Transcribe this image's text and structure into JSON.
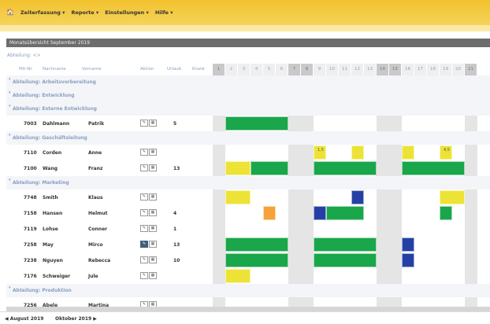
{
  "menubar": {
    "items": [
      {
        "label": "Zeiterfassung ▾",
        "name": "menu-zeiterfassung"
      },
      {
        "label": "Reporte ▾",
        "name": "menu-reporte"
      },
      {
        "label": "Einstellungen ▾",
        "name": "menu-einstellungen"
      },
      {
        "label": "Hilfe ▾",
        "name": "menu-hilfe"
      }
    ],
    "home_icon": "home-icon",
    "color": "#f2c12e"
  },
  "page_title": "Monatsübersicht September 2019",
  "filter_label": "Abteilung: <>",
  "columns": {
    "mit_nr": "Mit-Nr.",
    "nachname": "Nachname",
    "vorname": "Vorname",
    "aktion": "Aktion",
    "urlaub": "Urlaub",
    "krank": "Krank"
  },
  "days": [
    "1",
    "2",
    "3",
    "4",
    "5",
    "6",
    "7",
    "8",
    "9",
    "10",
    "11",
    "12",
    "13",
    "14",
    "15",
    "16",
    "17",
    "18",
    "19",
    "20",
    "21"
  ],
  "weekend_days": [
    1,
    7,
    8,
    14,
    15,
    21
  ],
  "departments": [
    {
      "label": "Abteilung: Arbeitsvorbereitung"
    },
    {
      "label": "Abteilung: Entwicklung"
    },
    {
      "label": "Abteilung: Externe Entwicklung"
    },
    {
      "label": "Abteilung: Geschäftsleitung"
    },
    {
      "label": "Abteilung: Marketing"
    },
    {
      "label": "Abteilung: Produktion"
    }
  ],
  "employees": [
    {
      "nr": "7003",
      "nachname": "Dahlmann",
      "vorname": "Patrik",
      "urlaub": "5",
      "krank": ""
    },
    {
      "nr": "7110",
      "nachname": "Corden",
      "vorname": "Anne",
      "urlaub": "",
      "krank": ""
    },
    {
      "nr": "7100",
      "nachname": "Wang",
      "vorname": "Franz",
      "urlaub": "13",
      "krank": ""
    },
    {
      "nr": "7748",
      "nachname": "Smith",
      "vorname": "Klaus",
      "urlaub": "",
      "krank": ""
    },
    {
      "nr": "7158",
      "nachname": "Hansen",
      "vorname": "Helmut",
      "urlaub": "4",
      "krank": ""
    },
    {
      "nr": "7119",
      "nachname": "Lohse",
      "vorname": "Conner",
      "urlaub": "1",
      "krank": ""
    },
    {
      "nr": "7258",
      "nachname": "May",
      "vorname": "Mirco",
      "urlaub": "13",
      "krank": ""
    },
    {
      "nr": "7238",
      "nachname": "Nguyen",
      "vorname": "Rebecca",
      "urlaub": "10",
      "krank": ""
    },
    {
      "nr": "7176",
      "nachname": "Schweiger",
      "vorname": "Jule",
      "urlaub": "",
      "krank": ""
    },
    {
      "nr": "7256",
      "nachname": "Abele",
      "vorname": "Martina",
      "urlaub": "",
      "krank": ""
    }
  ],
  "marks": [
    {
      "row": 0,
      "start": 2,
      "end": 6,
      "color": "#1aa64a"
    },
    {
      "row": 1,
      "start": 9,
      "end": 9,
      "color": "#ede337",
      "text": "1,5"
    },
    {
      "row": 1,
      "start": 12,
      "end": 12,
      "color": "#ede337"
    },
    {
      "row": 1,
      "start": 16,
      "end": 16,
      "color": "#ede337"
    },
    {
      "row": 1,
      "start": 19,
      "end": 19,
      "color": "#ede337",
      "text": "4,5"
    },
    {
      "row": 2,
      "start": 2,
      "end": 3,
      "color": "#ede337"
    },
    {
      "row": 2,
      "start": 4,
      "end": 6,
      "color": "#1aa64a"
    },
    {
      "row": 2,
      "start": 9,
      "end": 13,
      "color": "#1aa64a"
    },
    {
      "row": 2,
      "start": 16,
      "end": 20,
      "color": "#1aa64a"
    },
    {
      "row": 3,
      "start": 2,
      "end": 3,
      "color": "#ede337"
    },
    {
      "row": 3,
      "start": 12,
      "end": 12,
      "color": "#2540a5"
    },
    {
      "row": 3,
      "start": 19,
      "end": 20,
      "color": "#ede337"
    },
    {
      "row": 4,
      "start": 5,
      "end": 5,
      "color": "#f5a23a"
    },
    {
      "row": 4,
      "start": 9,
      "end": 9,
      "color": "#2540a5"
    },
    {
      "row": 4,
      "start": 10,
      "end": 12,
      "color": "#1aa64a"
    },
    {
      "row": 4,
      "start": 19,
      "end": 19,
      "color": "#1aa64a"
    },
    {
      "row": 6,
      "start": 2,
      "end": 6,
      "color": "#1aa64a"
    },
    {
      "row": 6,
      "start": 9,
      "end": 13,
      "color": "#1aa64a"
    },
    {
      "row": 6,
      "start": 16,
      "end": 16,
      "color": "#2540a5"
    },
    {
      "row": 7,
      "start": 2,
      "end": 6,
      "color": "#1aa64a"
    },
    {
      "row": 7,
      "start": 9,
      "end": 13,
      "color": "#1aa64a"
    },
    {
      "row": 7,
      "start": 16,
      "end": 16,
      "color": "#2540a5"
    },
    {
      "row": 8,
      "start": 2,
      "end": 3,
      "color": "#ede337"
    }
  ],
  "footer": {
    "prev": "◀ August 2019",
    "next": "Oktober 2019 ▶"
  }
}
